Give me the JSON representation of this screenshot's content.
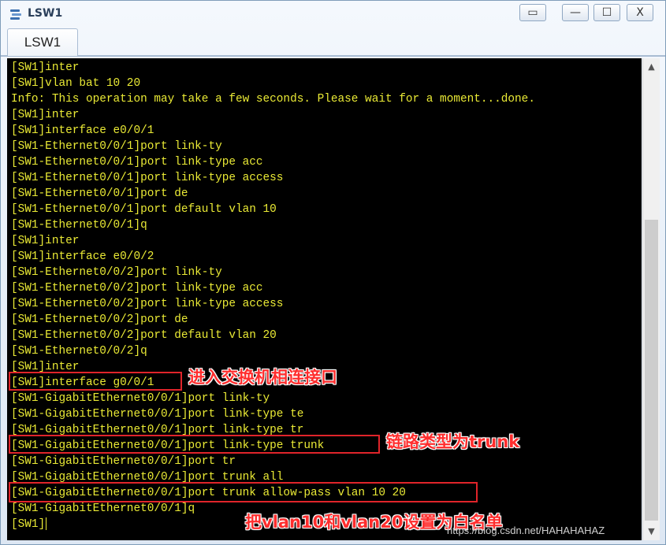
{
  "window": {
    "title": "LSW1"
  },
  "tabs": [
    {
      "label": "LSW1"
    }
  ],
  "window_buttons": {
    "restore": "▭",
    "minimize": "—",
    "maximize": "☐",
    "close": "X"
  },
  "terminal": {
    "lines": [
      "[SW1]inter",
      "[SW1]vlan bat 10 20",
      "Info: This operation may take a few seconds. Please wait for a moment...done.",
      "[SW1]inter",
      "[SW1]interface e0/0/1",
      "[SW1-Ethernet0/0/1]port link-ty",
      "[SW1-Ethernet0/0/1]port link-type acc",
      "[SW1-Ethernet0/0/1]port link-type access",
      "[SW1-Ethernet0/0/1]port de",
      "[SW1-Ethernet0/0/1]port default vlan 10",
      "[SW1-Ethernet0/0/1]q",
      "[SW1]inter",
      "[SW1]interface e0/0/2",
      "[SW1-Ethernet0/0/2]port link-ty",
      "[SW1-Ethernet0/0/2]port link-type acc",
      "[SW1-Ethernet0/0/2]port link-type access",
      "[SW1-Ethernet0/0/2]port de",
      "[SW1-Ethernet0/0/2]port default vlan 20",
      "[SW1-Ethernet0/0/2]q",
      "[SW1]inter",
      "[SW1]interface g0/0/1",
      "[SW1-GigabitEthernet0/0/1]port link-ty",
      "[SW1-GigabitEthernet0/0/1]port link-type te",
      "[SW1-GigabitEthernet0/0/1]port link-type tr",
      "[SW1-GigabitEthernet0/0/1]port link-type trunk",
      "[SW1-GigabitEthernet0/0/1]port tr",
      "[SW1-GigabitEthernet0/0/1]port trunk all",
      "[SW1-GigabitEthernet0/0/1]port trunk allow-pass vlan 10 20",
      "[SW1-GigabitEthernet0/0/1]q",
      "[SW1]"
    ]
  },
  "annotations": [
    "进入交换机相连接口",
    "链路类型为trunk",
    "把vlan10和vlan20设置为白名单"
  ],
  "scrollbar": {
    "up": "▲",
    "down": "▼"
  },
  "watermark": "https://blog.csdn.net/HAHAHAHAZ",
  "colors": {
    "terminal_bg": "#000000",
    "terminal_text": "#eaea35",
    "highlight": "#e0242a",
    "note": "#ff2d2d"
  },
  "icons": {
    "app": "switch-icon"
  }
}
